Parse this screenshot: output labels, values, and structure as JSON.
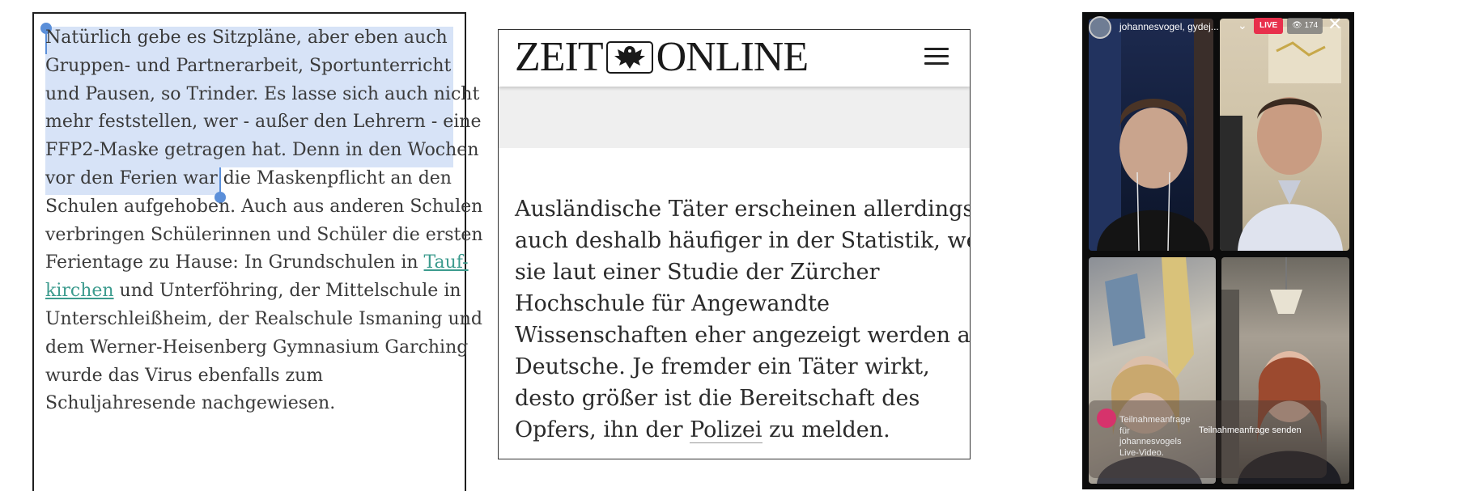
{
  "panel_article": {
    "lines": [
      "Natürlich gebe es Sitzpläne, aber eben auch",
      "Gruppen- und Partnerarbeit, Sportunterricht",
      "und Pausen, so Trinder. Es lasse sich auch nicht",
      "mehr feststellen, wer - außer den Lehrern - eine",
      "FFP2-Maske getragen hat. Denn in den Wochen",
      "vor den Ferien war die Maskenpflicht an den"
    ],
    "line7_selected": "Schulen aufgehoben.",
    "line7_rest": " Auch aus anderen Schulen",
    "line8": "verbringen Schülerinnen und Schüler die ersten",
    "line9_text": "Ferientage zu Hause: In Grundschulen in ",
    "line9_link": "Tauf-",
    "line10_link": "kirchen",
    "line10_text": " und Unterföhring, der Mittelschule in",
    "lines_after": [
      "Unterschleißheim, der Realschule Ismaning und",
      "dem Werner-Heisenberg Gymnasium Garching",
      "wurde das Virus ebenfalls zum",
      "Schuljahresende nachgewiesen."
    ]
  },
  "panel_zeit": {
    "logo_left": "ZEIT",
    "logo_right": "ONLINE",
    "lines": [
      "Ausländische Täter erscheinen allerdings",
      "auch deshalb häufiger in der Statistik, weil",
      "sie laut einer Studie der Zürcher",
      "Hochschule für Angewandte",
      "Wissenschaften eher angezeigt werden als",
      "Deutsche. Je fremder ein Täter wirkt,",
      "desto größer ist die Bereitschaft des"
    ],
    "last_before": "Opfers, ihn der ",
    "last_link": "Polizei",
    "last_after": " zu melden."
  },
  "panel_live": {
    "username": "johannesvogel, gydej...",
    "chevron": "⌄",
    "live_badge": "LIVE",
    "viewers": "👁 174",
    "close": "✕",
    "request_text": "Teilnahmeanfrage für johannesvogels Live-Video.",
    "request_button": "Teilnahmeanfrage senden"
  }
}
